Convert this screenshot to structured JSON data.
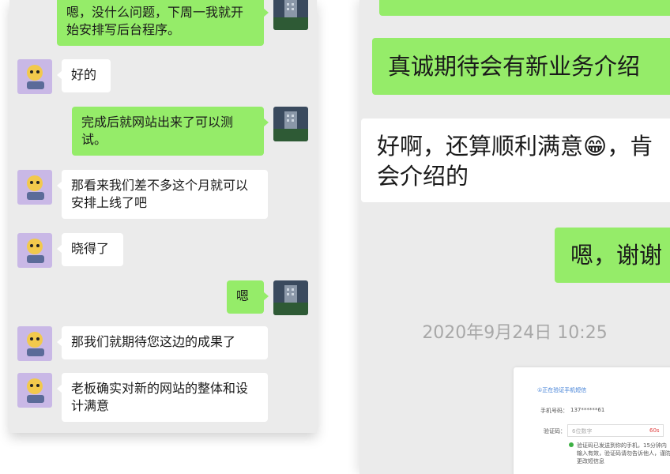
{
  "left_chat": {
    "messages": [
      {
        "side": "right",
        "text": "嗯，没什么问题，下周一我就开始安排写后台程序。"
      },
      {
        "side": "left",
        "text": "好的"
      },
      {
        "side": "right",
        "text": "完成后就网站出来了可以测试。"
      },
      {
        "side": "left",
        "text": "那看来我们差不多这个月就可以安排上线了吧"
      },
      {
        "side": "left",
        "text": "晓得了"
      },
      {
        "side": "right",
        "text": "嗯"
      },
      {
        "side": "left",
        "text": "那我们就期待您这边的成果了"
      },
      {
        "side": "left",
        "text": "老板确实对新的网站的整体和设计满意"
      }
    ]
  },
  "right_chat": {
    "messages": [
      {
        "side": "right",
        "text": "真诚期待会有新业务介绍"
      },
      {
        "side": "left",
        "line1": "好啊，还算顺利满意",
        "emoji": "😁",
        "line1_tail": "，肯",
        "line2": "会介绍的"
      },
      {
        "side": "right",
        "text": "嗯，谢谢"
      }
    ],
    "timestamp": "2020年9月24日 10:25",
    "screenshot_card": {
      "header": "①正在验证手机短信",
      "phone_label": "手机号码：",
      "phone_value": "137******61",
      "code_label": "验证码：",
      "code_placeholder": "6位数字",
      "code_timer": "60s",
      "hint_1": "验证码已发送到你的手机，15分钟内",
      "hint_2": "输入有效，验证码请勿告诉他人，谨防诈骗",
      "hint_3": "更改短信息"
    }
  },
  "colors": {
    "background": "#ebebeb",
    "green_bubble": "#95ec69",
    "white_bubble": "#ffffff",
    "timestamp": "#a8a8a8"
  }
}
